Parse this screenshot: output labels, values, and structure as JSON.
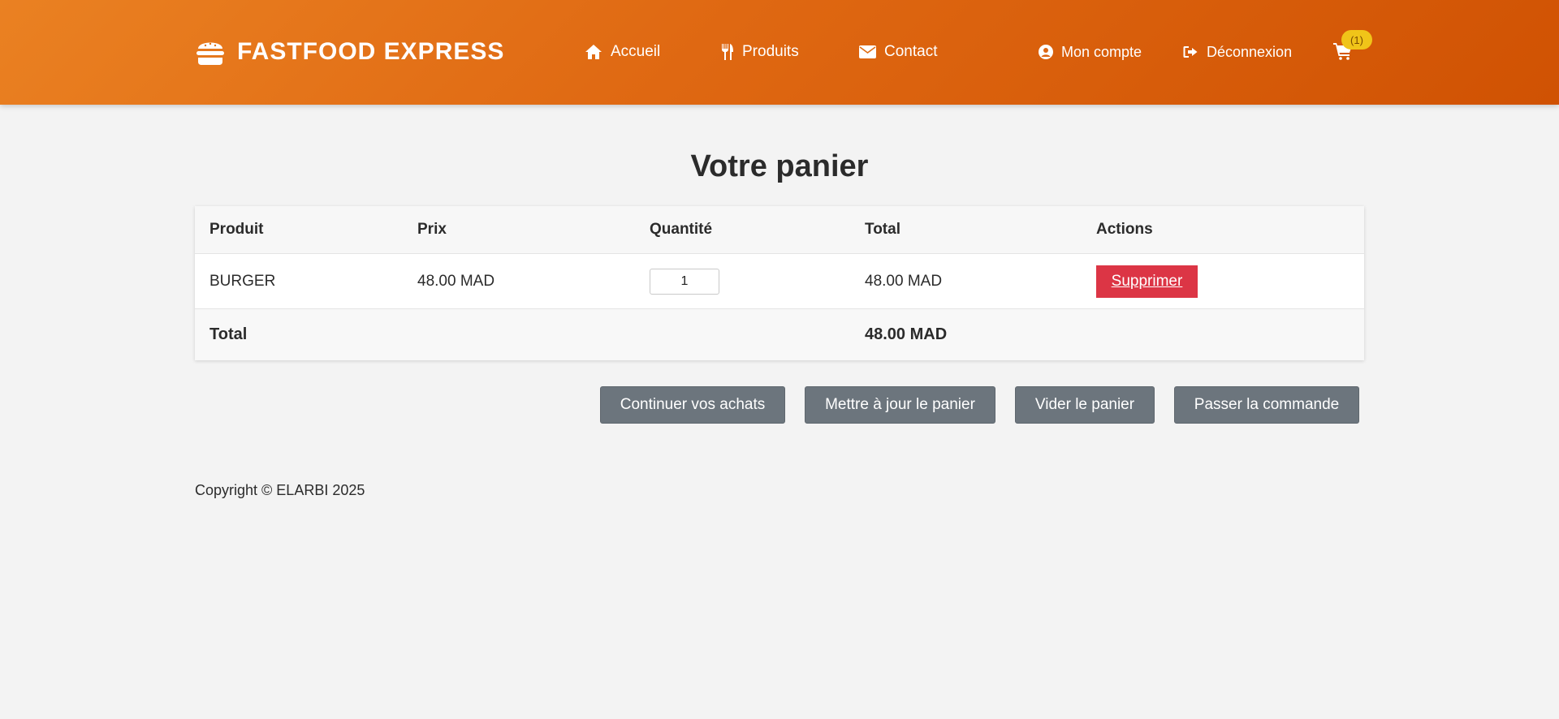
{
  "header": {
    "logo_icon": "burger-icon",
    "brand": "FASTFOOD EXPRESS",
    "nav": [
      {
        "label": "Accueil",
        "icon": "home-icon"
      },
      {
        "label": "Produits",
        "icon": "utensils-icon"
      },
      {
        "label": "Contact",
        "icon": "envelope-icon"
      },
      {
        "label": "Mon compte",
        "icon": "user-circle-icon"
      },
      {
        "label": "Déconnexion",
        "icon": "sign-out-icon"
      }
    ],
    "cart_icon": "cart-icon",
    "cart_count": "(1)"
  },
  "main": {
    "title": "Votre panier",
    "table": {
      "headers": [
        "Produit",
        "Prix",
        "Quantité",
        "Total",
        "Actions"
      ],
      "rows": [
        {
          "product": "BURGER",
          "price": "48.00 MAD",
          "quantity": "1",
          "total": "48.00 MAD",
          "action": "Supprimer"
        }
      ],
      "footer": {
        "label": "Total",
        "value": "48.00 MAD"
      }
    },
    "buttons": {
      "continue": "Continuer vos achats",
      "update": "Mettre à jour le panier",
      "empty": "Vider le panier",
      "checkout": "Passer la commande"
    }
  },
  "footer": {
    "copyright": "Copyright © ELARBI 2025"
  },
  "colors": {
    "header_start": "#ea8122",
    "header_end": "#d05203",
    "delete_button": "#dc3545",
    "secondary_button": "#6c757d",
    "badge": "#f0c419"
  }
}
